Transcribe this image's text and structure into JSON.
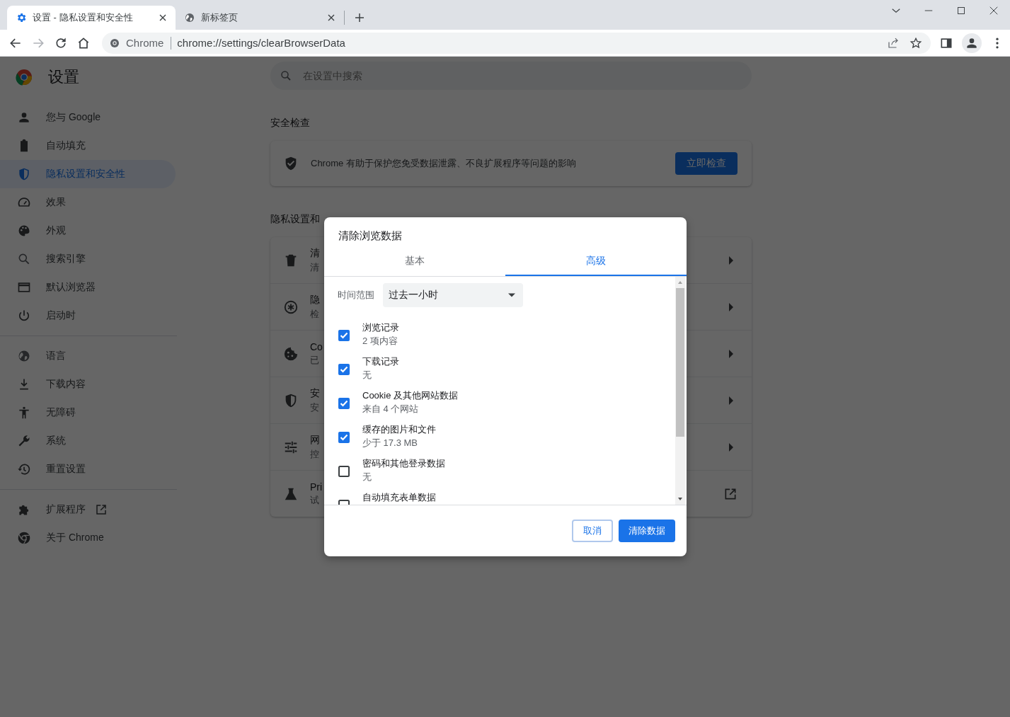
{
  "browser": {
    "tabs": [
      {
        "title": "设置 - 隐私设置和安全性",
        "selected": true
      },
      {
        "title": "新标签页",
        "selected": false
      }
    ],
    "omnibox": {
      "site_label": "Chrome",
      "url": "chrome://settings/clearBrowserData"
    }
  },
  "settings": {
    "title": "设置",
    "search_placeholder": "在设置中搜索",
    "nav_groups": [
      [
        {
          "label": "您与 Google",
          "selected": false
        },
        {
          "label": "自动填充",
          "selected": false
        },
        {
          "label": "隐私设置和安全性",
          "selected": true
        },
        {
          "label": "效果",
          "selected": false
        },
        {
          "label": "外观",
          "selected": false
        },
        {
          "label": "搜索引擎",
          "selected": false
        },
        {
          "label": "默认浏览器",
          "selected": false
        },
        {
          "label": "启动时",
          "selected": false
        }
      ],
      [
        {
          "label": "语言",
          "selected": false
        },
        {
          "label": "下载内容",
          "selected": false
        },
        {
          "label": "无障碍",
          "selected": false
        },
        {
          "label": "系统",
          "selected": false
        },
        {
          "label": "重置设置",
          "selected": false
        }
      ],
      [
        {
          "label": "扩展程序",
          "selected": false,
          "external": true
        },
        {
          "label": "关于 Chrome",
          "selected": false,
          "external": false
        }
      ]
    ],
    "safety_check": {
      "heading": "安全检查",
      "text": "Chrome 有助于保护您免受数据泄露、不良扩展程序等问题的影响",
      "button": "立即检查"
    },
    "privacy": {
      "heading": "隐私设置和",
      "rows": [
        {
          "title": "清",
          "subtitle": "清",
          "kind": "arrow"
        },
        {
          "title": "隐",
          "subtitle": "检",
          "kind": "arrow"
        },
        {
          "title": "Co",
          "subtitle": "已",
          "kind": "arrow"
        },
        {
          "title": "安",
          "subtitle": "安",
          "kind": "arrow"
        },
        {
          "title": "网",
          "subtitle": "控",
          "kind": "arrow"
        },
        {
          "title": "Pri",
          "subtitle": "试",
          "kind": "external"
        }
      ]
    }
  },
  "dialog": {
    "title": "清除浏览数据",
    "tabs": [
      {
        "label": "基本",
        "selected": false
      },
      {
        "label": "高级",
        "selected": true
      }
    ],
    "time_range": {
      "label": "时间范围",
      "value": "过去一小时"
    },
    "items": [
      {
        "title": "浏览记录",
        "detail": "2 项内容",
        "checked": true
      },
      {
        "title": "下载记录",
        "detail": "无",
        "checked": true
      },
      {
        "title": "Cookie 及其他网站数据",
        "detail": "来自 4 个网站",
        "checked": true
      },
      {
        "title": "缓存的图片和文件",
        "detail": "少于 17.3 MB",
        "checked": true
      },
      {
        "title": "密码和其他登录数据",
        "detail": "无",
        "checked": false
      },
      {
        "title": "自动填充表单数据",
        "checked": false
      }
    ],
    "buttons": [
      {
        "label": "取消",
        "kind": "secondary"
      },
      {
        "label": "清除数据",
        "kind": "primary"
      }
    ]
  }
}
